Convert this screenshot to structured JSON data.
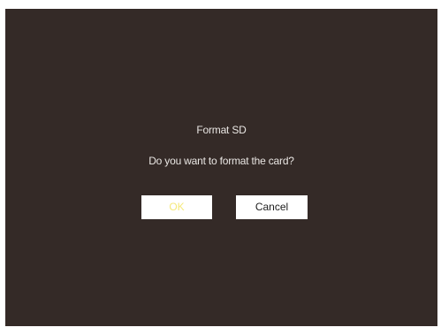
{
  "dialog": {
    "title": "Format SD",
    "message": "Do you want to format the card?",
    "ok_label": "OK",
    "cancel_label": "Cancel",
    "selected_button": "OK"
  },
  "colors": {
    "screen_background": "#342a27",
    "text": "#e9e6e3",
    "button_background": "#ffffff",
    "selected_label": "#f5e97a",
    "unselected_label": "#1d1d1d"
  }
}
